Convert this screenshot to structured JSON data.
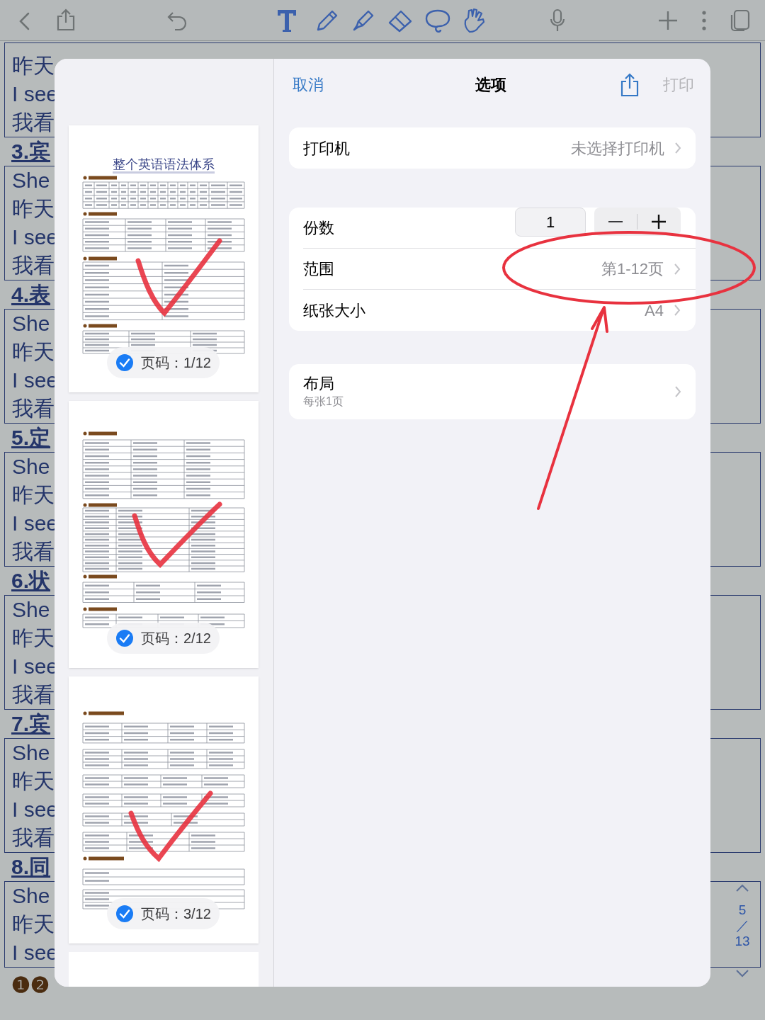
{
  "note": {
    "intro_lines": [
      "昨天",
      "I see",
      "我看"
    ],
    "sections": [
      {
        "heading": "3.宾",
        "lines": [
          "She",
          "昨天",
          "I see",
          "我看"
        ]
      },
      {
        "heading": "4.表",
        "lines": [
          "She",
          "昨天",
          "I see",
          "我看"
        ]
      },
      {
        "heading": "5.定",
        "lines": [
          "She",
          "昨天",
          "I see",
          "我看"
        ]
      },
      {
        "heading": "6.状",
        "lines": [
          "She",
          "昨天",
          "I see",
          "我看"
        ]
      },
      {
        "heading": "7.宾",
        "lines": [
          "She",
          "昨天",
          "I see",
          "我看"
        ]
      },
      {
        "heading": "8.同",
        "lines": [
          "She",
          "昨天",
          "I see"
        ]
      }
    ],
    "footer_heading": "❶❷"
  },
  "page_indicator": {
    "current": "5",
    "separator": "／",
    "total": "13"
  },
  "print_dialog": {
    "cancel": "取消",
    "title": "选项",
    "print": "打印",
    "print_disabled": true,
    "printer": {
      "label": "打印机",
      "value": "未选择打印机"
    },
    "copies": {
      "label": "份数",
      "value": "1"
    },
    "range": {
      "label": "范围",
      "value": "第1-12页"
    },
    "paper": {
      "label": "纸张大小",
      "value": "A4"
    },
    "layout": {
      "label": "布局",
      "detail": "每张1页"
    }
  },
  "thumbnails": [
    {
      "title": "整个英语语法体系",
      "badge": "页码：1/12",
      "selected": true
    },
    {
      "badge": "页码：2/12",
      "selected": true
    },
    {
      "badge": "页码：3/12",
      "selected": true
    }
  ],
  "partial_page": true
}
